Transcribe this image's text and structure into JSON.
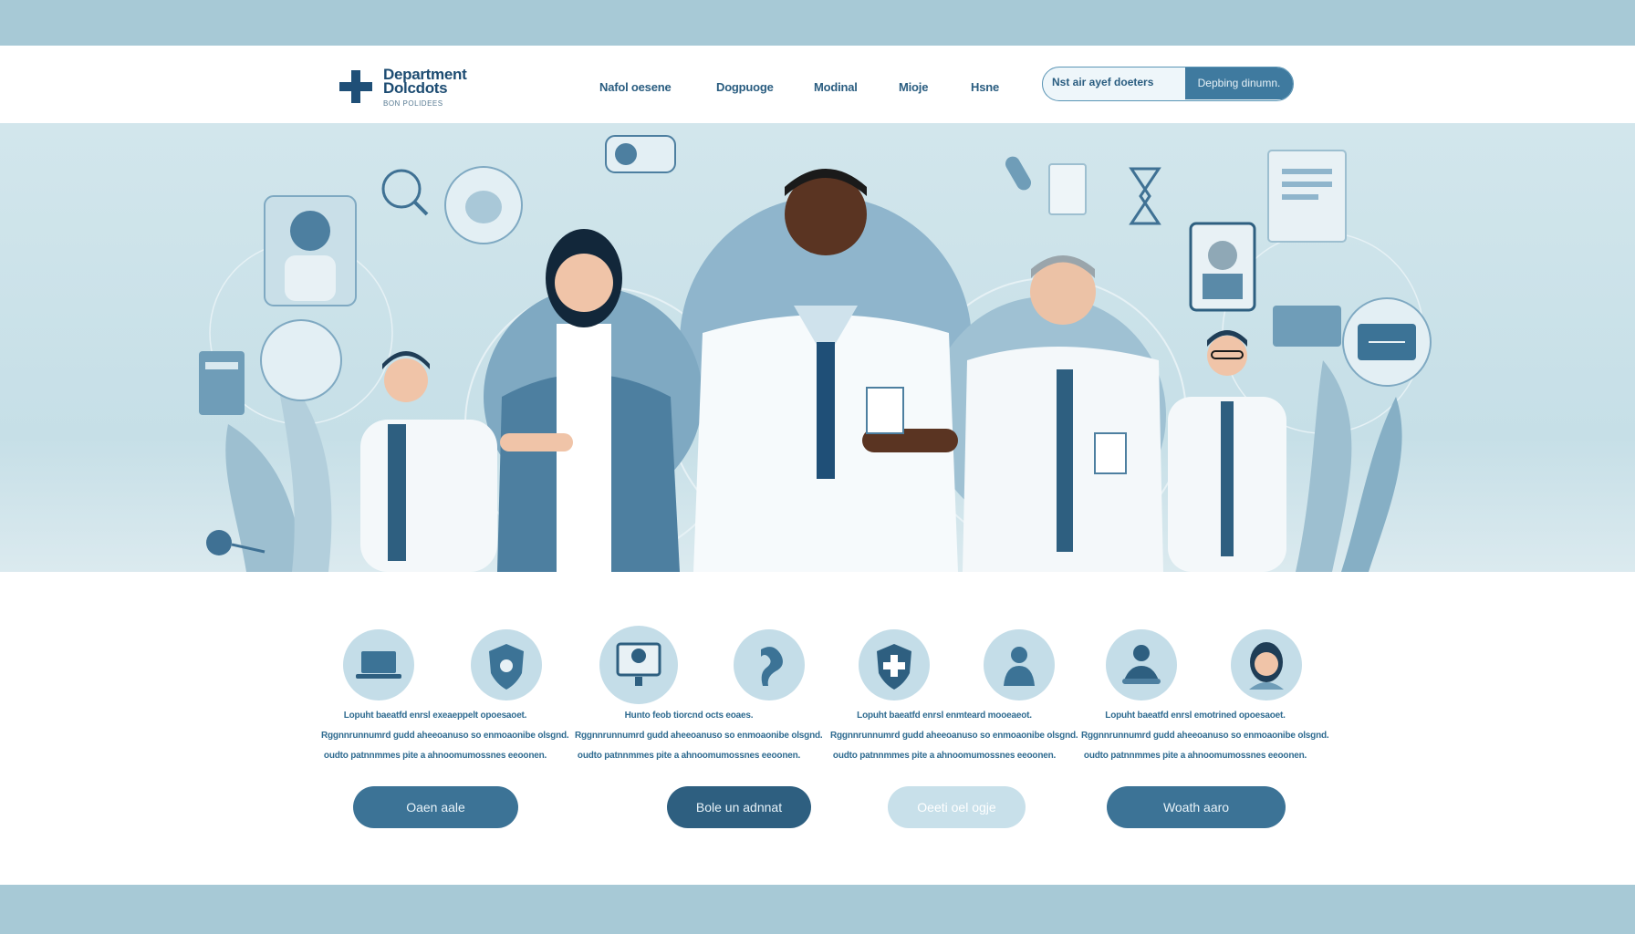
{
  "colors": {
    "accent": "#3c7396",
    "navy": "#1d4c72",
    "bar": "#a7c9d6",
    "hero_bg": "#cfe4eb"
  },
  "logo": {
    "title_line1": "Department",
    "title_line2": "Dolcdots",
    "subtitle": "BON POLIDEES"
  },
  "nav": [
    {
      "label": "Nafol oesene"
    },
    {
      "label": "Dogpuoge"
    },
    {
      "label": "Modinal"
    },
    {
      "label": "Mioje"
    },
    {
      "label": "Hsne"
    }
  ],
  "search": {
    "placeholder": "Nst air ayef doeters",
    "button_label": "Depbing dinumn."
  },
  "hero": {
    "icon_names": [
      "search-icon",
      "lungs-icon",
      "document-icon",
      "hourglass-icon",
      "clipboard-icon",
      "monitor-icon",
      "capsule-icon"
    ]
  },
  "features": [
    {
      "line1": "Lopuht baeatfd enrsl exeaeppelt opoesaoet.",
      "line2": "Rggnnrunnumrd gudd aheeoanuso so enmoaonibe olsgnd.",
      "line3": "oudto patnnmmes pite a ahnoomumossnes eeoonen."
    },
    {
      "line1": "Hunto feob tiorcnd octs eoaes.",
      "line2": "Rggnnrunnumrd gudd aheeoanuso so enmoaonibe olsgnd.",
      "line3": "oudto patnnmmes pite a ahnoomumossnes eeoonen."
    },
    {
      "line1": "Lopuht baeatfd enrsl enmteard mooeaeot.",
      "line2": "Rggnnrunnumrd gudd aheeoanuso so enmoaonibe olsgnd.",
      "line3": "oudto patnnmmes pite a ahnoomumossnes eeoonen."
    },
    {
      "line1": "Lopuht baeatfd enrsl emotrined opoesaoet.",
      "line2": "Rggnnrunnumrd gudd aheeoanuso so enmoaonibe olsgnd.",
      "line3": "oudto patnnmmes pite a ahnoomumossnes eeoonen."
    }
  ],
  "buttons": [
    {
      "label": "Oaen aale"
    },
    {
      "label": "Bole un adnnat"
    },
    {
      "label": "Oeeti oel ogje"
    },
    {
      "label": "Woath aaro"
    }
  ]
}
